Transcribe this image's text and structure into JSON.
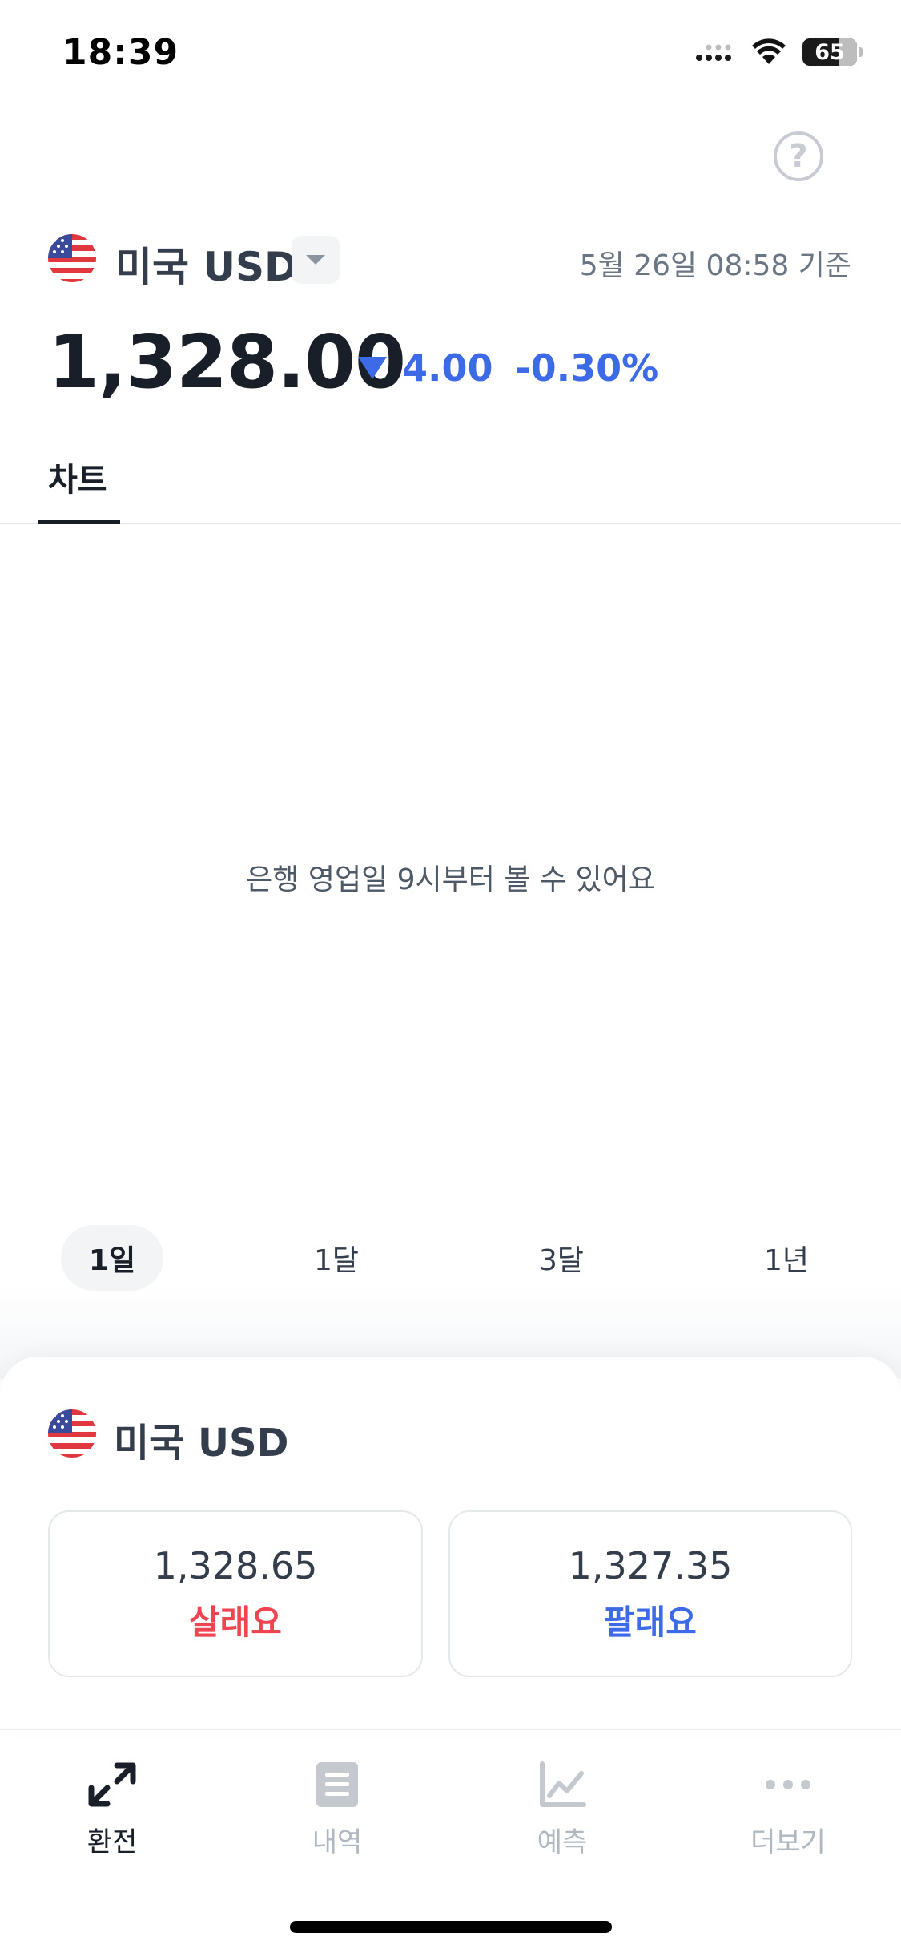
{
  "status_bar": {
    "time": "18:39",
    "battery": "65"
  },
  "currency": {
    "name": "미국 USD",
    "timestamp": "5월 26일 08:58 기준"
  },
  "rate": {
    "value": "1,328.00",
    "change": "4.00",
    "change_pct": "-0.30%",
    "direction": "down"
  },
  "tabs": [
    {
      "label": "차트"
    }
  ],
  "chart": {
    "empty_message": "은행 영업일 9시부터 볼 수 있어요"
  },
  "periods": [
    {
      "label": "1일",
      "active": true
    },
    {
      "label": "1달",
      "active": false
    },
    {
      "label": "3달",
      "active": false
    },
    {
      "label": "1년",
      "active": false
    }
  ],
  "trade": {
    "currency_name": "미국 USD",
    "buy": {
      "price": "1,328.65",
      "label": "살래요"
    },
    "sell": {
      "price": "1,327.35",
      "label": "팔래요"
    }
  },
  "nav": [
    {
      "label": "환전",
      "icon": "exchange-icon",
      "active": true
    },
    {
      "label": "내역",
      "icon": "document-icon",
      "active": false
    },
    {
      "label": "예측",
      "icon": "chart-icon",
      "active": false
    },
    {
      "label": "더보기",
      "icon": "more-icon",
      "active": false
    }
  ],
  "colors": {
    "accent_blue": "#3d6ae6",
    "buy_red": "#f04452",
    "text_primary": "#191f28"
  }
}
